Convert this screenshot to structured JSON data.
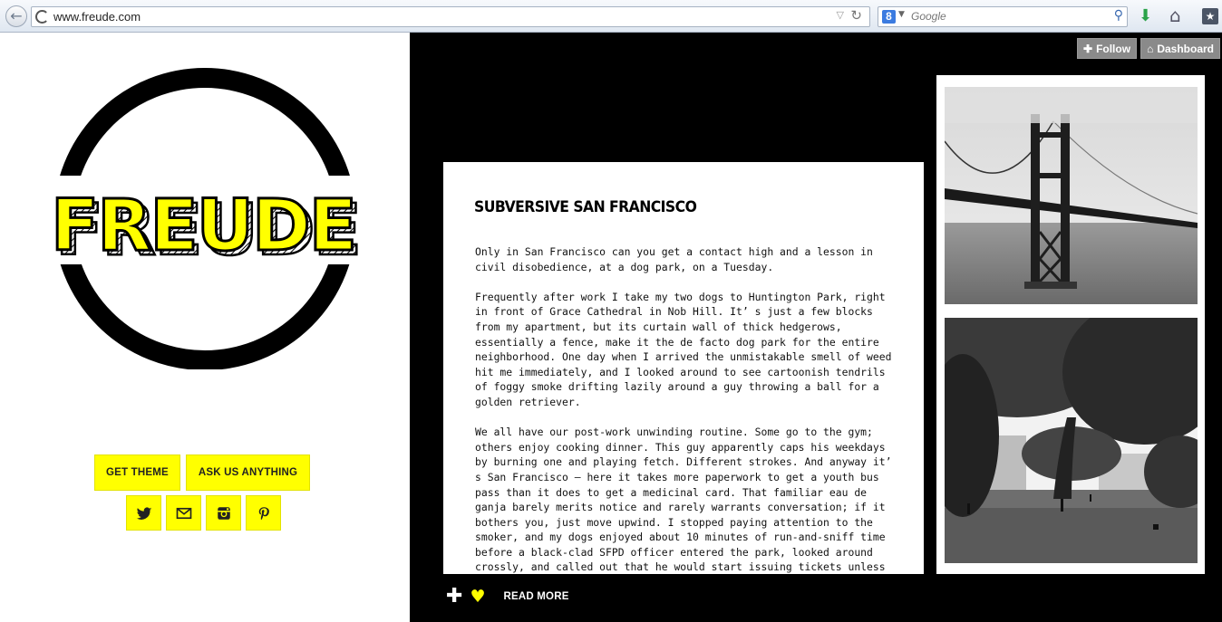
{
  "browser": {
    "url": "www.freude.com",
    "search_placeholder": "Google",
    "search_engine_letter": "8"
  },
  "sidebar": {
    "logo_text": "FREUDE",
    "buttons": [
      {
        "label": "GET THEME"
      },
      {
        "label": "ASK US ANYTHING"
      }
    ],
    "social_icons": [
      "twitter-icon",
      "mail-icon",
      "instagram-icon",
      "pinterest-icon"
    ]
  },
  "top_bar": {
    "follow_label": "Follow",
    "dashboard_label": "Dashboard"
  },
  "post": {
    "title": "SUBVERSIVE SAN FRANCISCO",
    "paragraphs": [
      "Only in San Francisco can you get a contact high and a  lesson in civil disobedience, at a dog park, on a Tuesday.",
      "Frequently after work I take my two dogs to Huntington Park, right in front of Grace Cathedral in Nob Hill. It’ s just a few blocks from my apartment, but its curtain wall of thick hedgerows, essentially a fence, make it the de facto dog park for the entire neighborhood.  One day when I arrived the unmistakable smell of weed hit me immediately, and I looked around to see cartoonish tendrils of foggy smoke drifting lazily around a guy throwing a ball for a golden retriever.",
      "We all have our post-work unwinding routine. Some go to the gym; others enjoy cooking dinner. This guy apparently caps his weekdays by burning one and playing fetch. Different strokes. And anyway it’ s San Francisco – here it takes more paperwork to get a youth bus pass than it does to get a medicinal card. That familiar eau de ganja barely merits notice and rarely warrants conversation; if it bothers you, just move upwind. I stopped paying attention to the smoker, and my dogs enjoyed about 10 minutes of run-and-sniff time before a black-clad SFPD officer entered the park, looked around crossly, and called out that he would start issuing tickets unless all dogs were promptly leashed."
    ],
    "read_more": "READ MORE"
  },
  "colors": {
    "accent_yellow": "#ffff00",
    "background_dark": "#000000"
  }
}
